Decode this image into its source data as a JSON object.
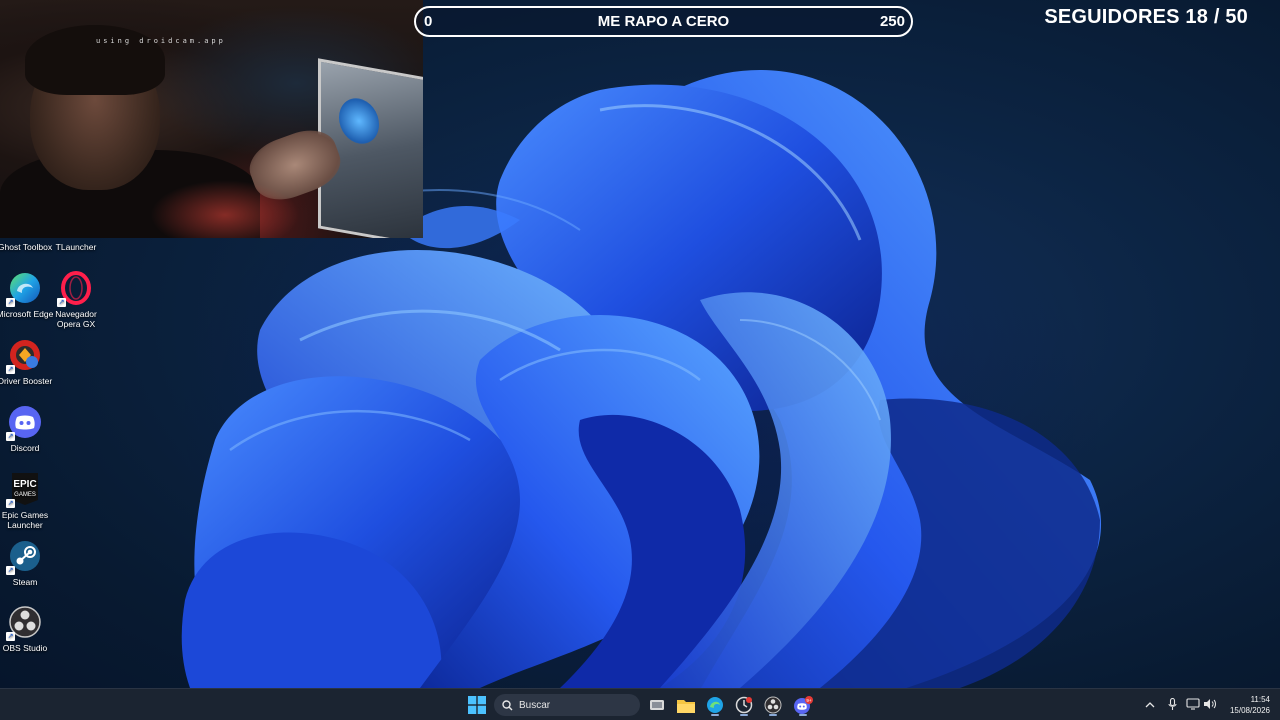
{
  "webcam": {
    "watermark": "using droidcam.app"
  },
  "goal": {
    "start": "0",
    "title": "ME RAPO A CERO",
    "end": "250"
  },
  "followers": {
    "text": "SEGUIDORES 18 / 50"
  },
  "desktop": {
    "icons": [
      {
        "label": "Ghost Toolbox",
        "icon": "ghost-toolbox-icon"
      },
      {
        "label": "TLauncher",
        "icon": "tlauncher-icon"
      },
      {
        "label": "Microsoft Edge",
        "icon": "edge-icon"
      },
      {
        "label": "Navegador Opera GX",
        "icon": "opera-gx-icon"
      },
      {
        "label": "Driver Booster",
        "icon": "driver-booster-icon"
      },
      {
        "label": "Discord",
        "icon": "discord-icon"
      },
      {
        "label": "Epic Games Launcher",
        "icon": "epic-games-icon"
      },
      {
        "label": "Steam",
        "icon": "steam-icon"
      },
      {
        "label": "OBS Studio",
        "icon": "obs-studio-icon"
      }
    ],
    "epic_logo_text": "EPIC\nGAMES"
  },
  "taskbar": {
    "search_label": "Buscar",
    "discord_badge": "9+",
    "time": "11:54",
    "date": "15/08/2026"
  },
  "colors": {
    "accent": "#2f6df6",
    "taskbar": "#1b2431",
    "desktop_bg": "#0c2443"
  }
}
